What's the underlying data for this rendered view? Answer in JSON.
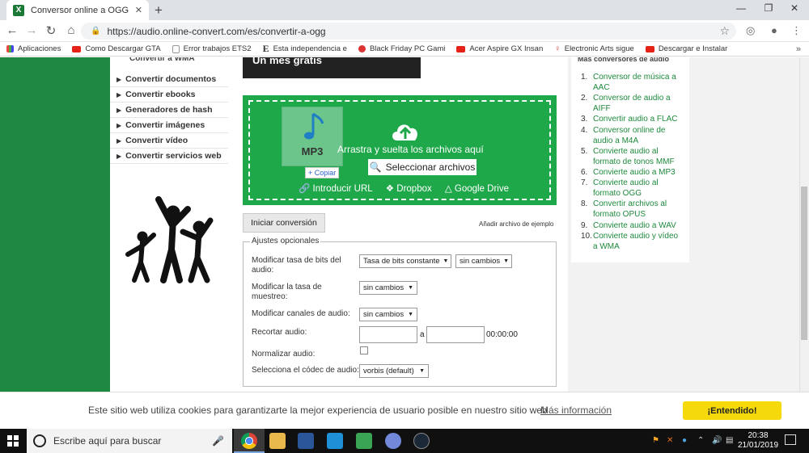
{
  "browser": {
    "tab_title": "Conversor online a OGG",
    "tab_favicon_text": "X",
    "url": "https://audio.online-convert.com/es/convertir-a-ogg",
    "bookmarks": [
      {
        "label": "Aplicaciones",
        "icon": "apps-grid-icon"
      },
      {
        "label": "Como Descargar GTA",
        "icon": "youtube-icon"
      },
      {
        "label": "Error trabajos ETS2",
        "icon": "page-icon"
      },
      {
        "label": "Esta independencia e",
        "icon": "e-logo-icon"
      },
      {
        "label": "Black Friday PC Gami",
        "icon": "site-icon"
      },
      {
        "label": "Acer Aspire GX Insan",
        "icon": "youtube-icon"
      },
      {
        "label": "Electronic Arts sigue",
        "icon": "figure-icon"
      },
      {
        "label": "Descargar e Instalar",
        "icon": "youtube-icon"
      }
    ],
    "bookmarks_overflow": "»"
  },
  "leftnav": {
    "partial_top": "Convertir a WMA",
    "items": [
      "Convertir documentos",
      "Convertir ebooks",
      "Generadores de hash",
      "Convertir imágenes",
      "Convertir vídeo",
      "Convertir servicios web"
    ]
  },
  "promo": {
    "text": "Un mes gratis"
  },
  "upload": {
    "file_label": "MP3",
    "copy_tooltip": "+ Copiar",
    "drag_text": "Arrastra y suelta los archivos aquí",
    "select_button": "Seleccionar archivos",
    "sources": [
      "Introducir URL",
      "Dropbox",
      "Google Drive"
    ]
  },
  "actions": {
    "convert_button": "Iniciar conversión",
    "sample_link": "Añadir archivo de ejemplo"
  },
  "options": {
    "legend": "Ajustes opcionales",
    "bitrate_label": "Modificar tasa de bits del audio:",
    "bitrate_mode": "Tasa de bits constante",
    "bitrate_value": "sin cambios",
    "samplerate_label": "Modificar la tasa de muestreo:",
    "samplerate_value": "sin cambios",
    "channels_label": "Modificar canales de audio:",
    "channels_value": "sin cambios",
    "trim_label": "Recortar audio:",
    "trim_sep": "a",
    "trim_time": "00:00:00",
    "normalize_label": "Normalizar audio:",
    "codec_label": "Selecciona el códec de audio:",
    "codec_value": "vorbis (default)"
  },
  "rightcol": {
    "heading": "Más conversores de audio",
    "items": [
      "Conversor de música a AAC",
      "Conversor de audio a AIFF",
      "Convertir audio a FLAC",
      "Conversor online de audio a M4A",
      "Convierte audio al formato de tonos MMF",
      "Convierte audio a MP3",
      "Convierte audio al formato OGG",
      "Convertir archivos al formato OPUS",
      "Convierte audio a WAV",
      "Convierte audio y vídeo a WMA"
    ]
  },
  "cookie": {
    "text": "Este sitio web utiliza cookies para garantizarte la mejor experiencia de usuario posible en nuestro sitio web",
    "more": "Más información",
    "accept": "¡Entendido!"
  },
  "taskbar": {
    "search_placeholder": "Escribe aquí para buscar",
    "time": "20:38",
    "date": "21/01/2019"
  },
  "colors": {
    "brand_green": "#1e8740",
    "upload_green": "#1fa84a",
    "link_green": "#1e8a3c",
    "cookie_button": "#f5d90a"
  }
}
